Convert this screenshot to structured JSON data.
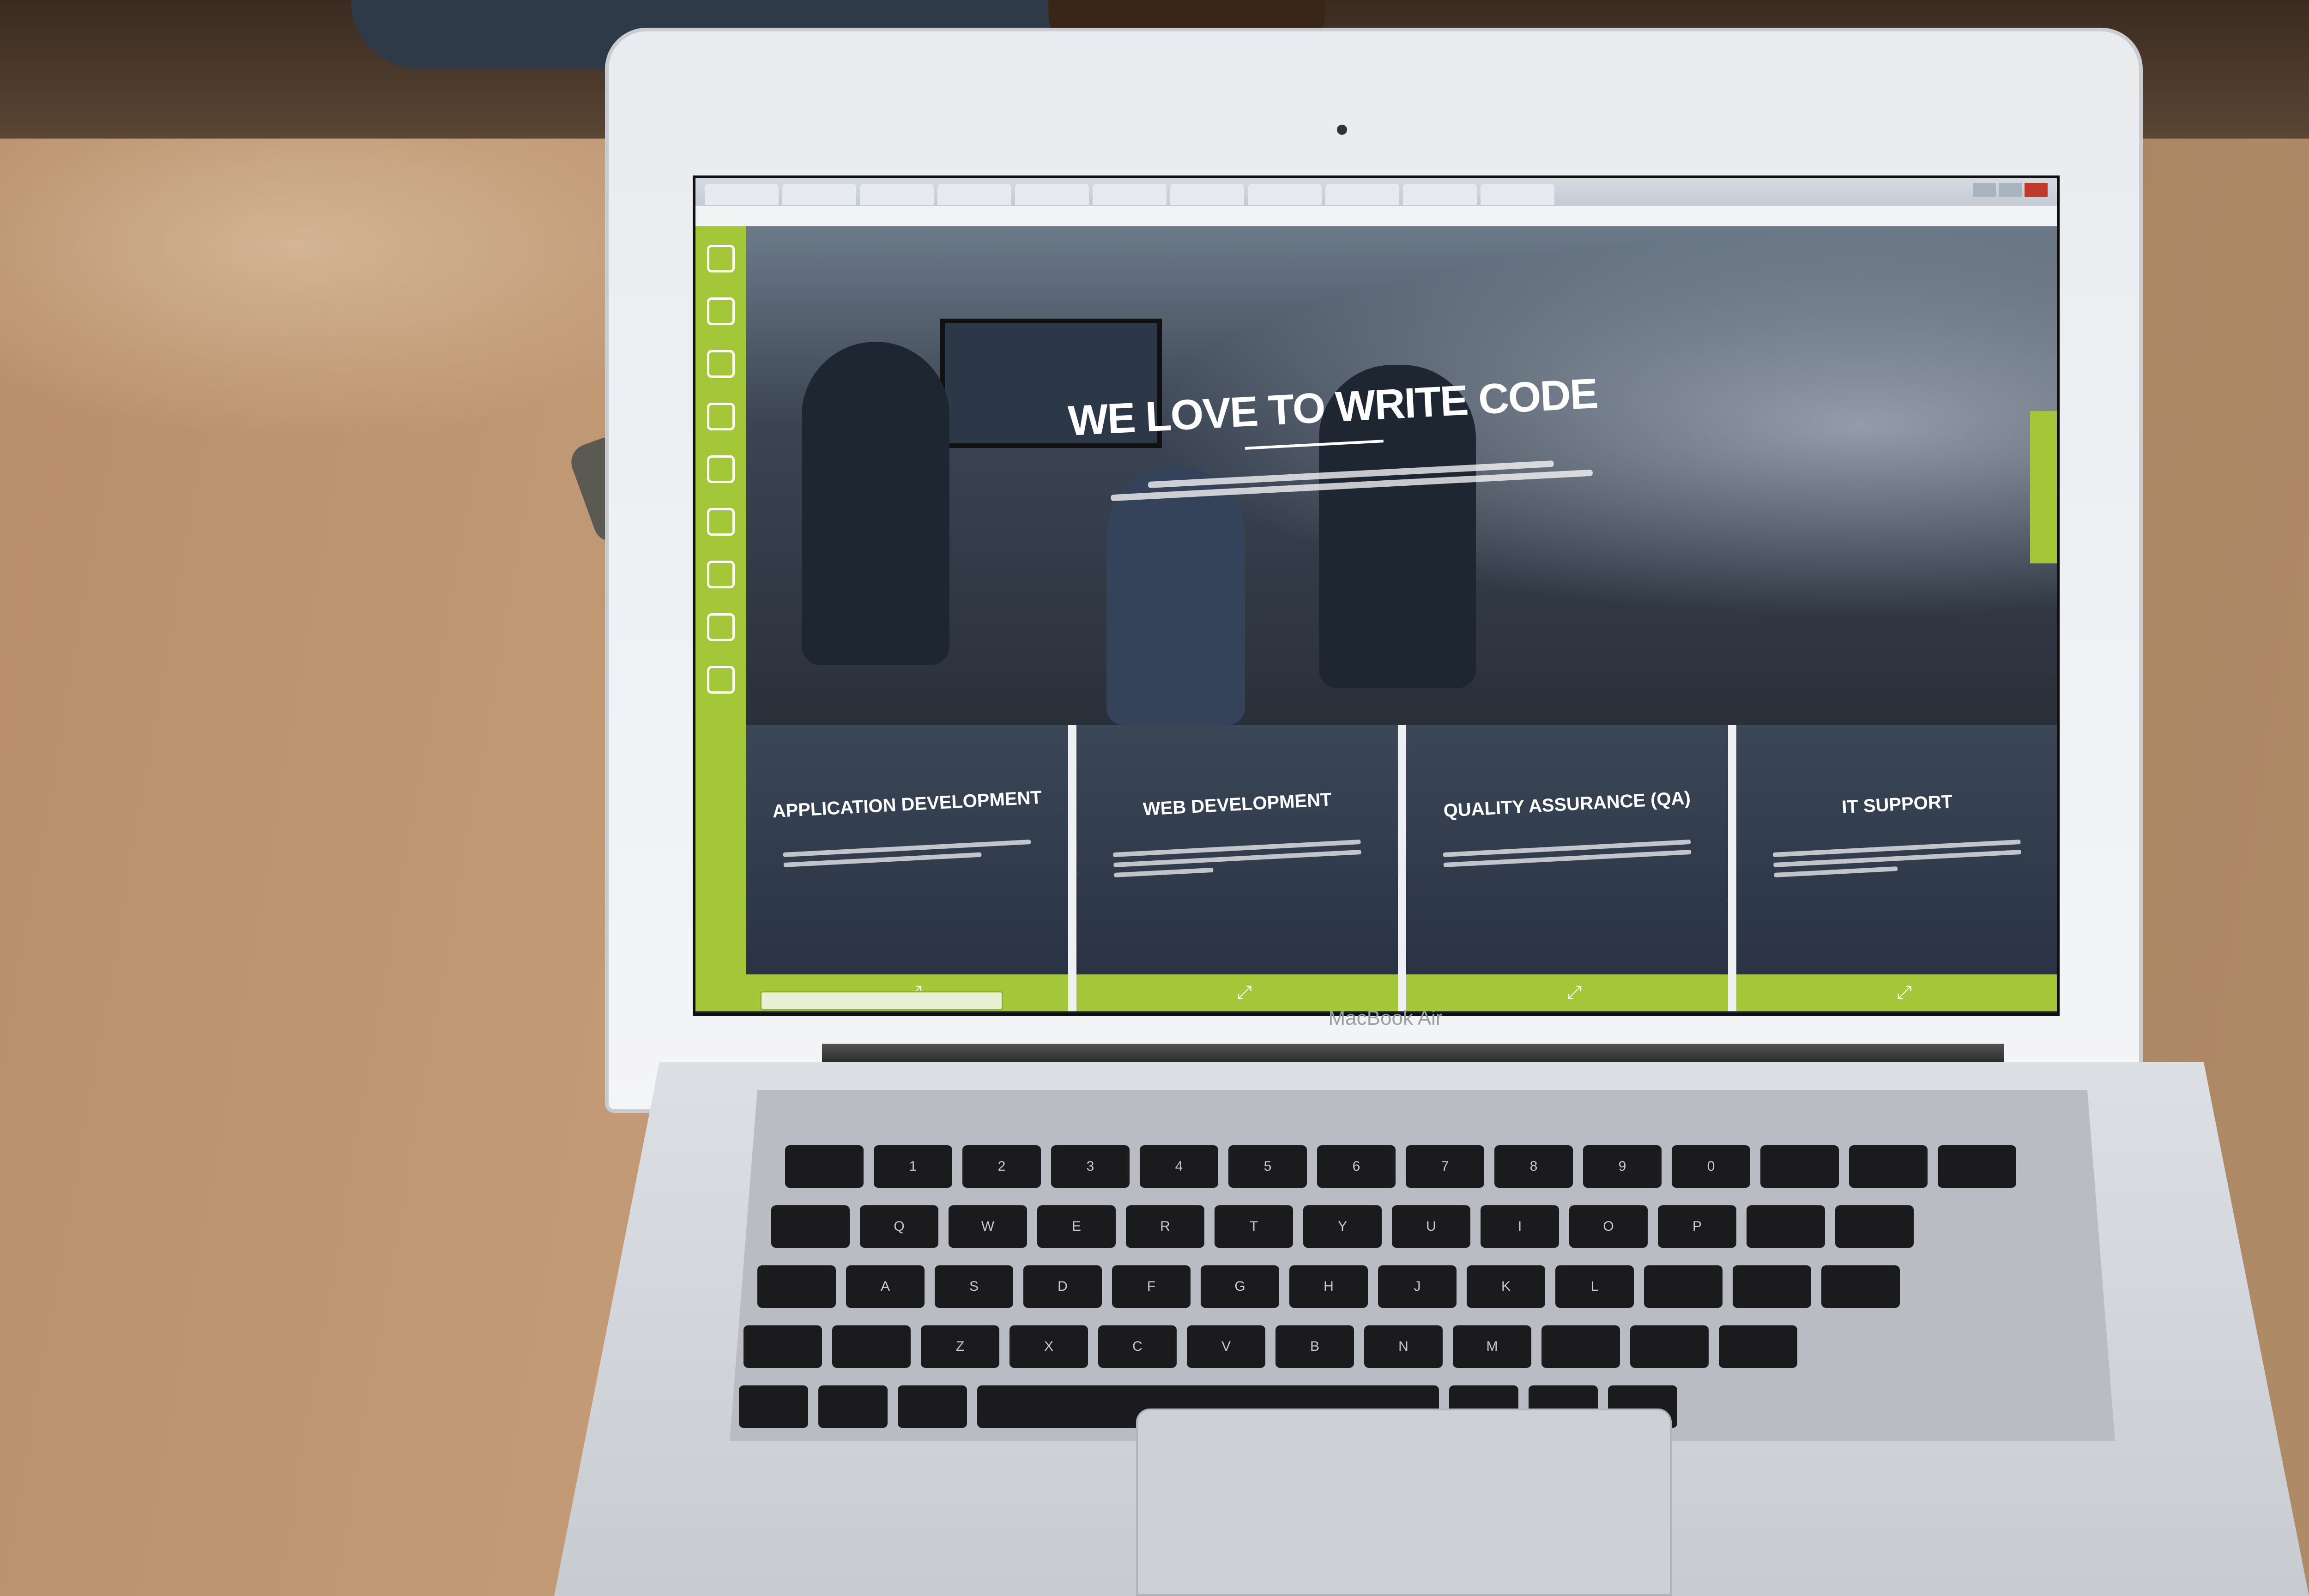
{
  "hero": {
    "title": "WE LOVE TO WRITE CODE"
  },
  "services": [
    {
      "title": "APPLICATION DEVELOPMENT"
    },
    {
      "title": "WEB DEVELOPMENT"
    },
    {
      "title": "QUALITY ASSURANCE (QA)"
    },
    {
      "title": "IT SUPPORT"
    }
  ],
  "laptop": {
    "model_label": "MacBook Air"
  },
  "keyboard": {
    "row_numbers": [
      "",
      "1",
      "2",
      "3",
      "4",
      "5",
      "6",
      "7",
      "8",
      "9",
      "0",
      "",
      "",
      ""
    ],
    "row_top": [
      "",
      "Q",
      "W",
      "E",
      "R",
      "T",
      "Y",
      "U",
      "I",
      "O",
      "P",
      "",
      ""
    ],
    "row_home": [
      "",
      "A",
      "S",
      "D",
      "F",
      "G",
      "H",
      "J",
      "K",
      "L",
      "",
      "",
      ""
    ],
    "row_bottom": [
      "",
      "",
      "Z",
      "X",
      "C",
      "V",
      "B",
      "N",
      "M",
      "",
      "",
      ""
    ]
  },
  "colors": {
    "accent": "#a4c639",
    "desk": "#b48a66",
    "lid": "#eef0f2"
  },
  "icons": [
    "menu-icon",
    "home-icon",
    "briefcase-icon",
    "pencil-icon",
    "gift-icon",
    "chat-icon",
    "monitor-icon",
    "cart-icon",
    "heart-icon"
  ]
}
